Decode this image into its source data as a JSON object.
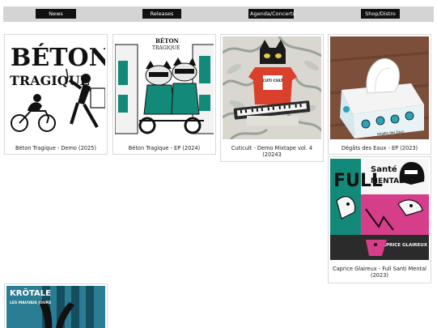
{
  "nav": {
    "items": [
      "News",
      "Releases",
      "Agenda/Concerts",
      "Shop/Distro"
    ]
  },
  "releases": [
    {
      "caption": "Béton Tragique - Demo (2025)",
      "art_title_1": "BÉTON",
      "art_title_2": "TRAGIQUE"
    },
    {
      "caption": "Béton Tragique - EP (2024)",
      "art_title_1": "BÉTON",
      "art_title_2": "TRAGIQUE"
    },
    {
      "caption": "Cuticult - Demo Mixtape vol. 4 (20243",
      "art_shirt": "CUTI CULT"
    },
    {
      "caption": "Dégâts des Eaux - EP (2023)",
      "art_box": "Dégâts des Eaux"
    },
    {
      "caption": "Caprice Glaireux - Full Santi Mental (2023)",
      "art_title_1": "FULL",
      "art_title_2": "Santé",
      "art_title_3": "MENTAL",
      "art_corner": "CAPRICE GLAIREUX"
    },
    {
      "caption": "",
      "art_title_1": "KRÖTALE",
      "art_title_2": "LES MAUVAIS JOURS"
    }
  ],
  "colors": {
    "nav_bg": "#d4d4d4",
    "nav_button": "#111111",
    "teal": "#138a79",
    "magenta": "#d63e8a",
    "red": "#d9412c"
  }
}
